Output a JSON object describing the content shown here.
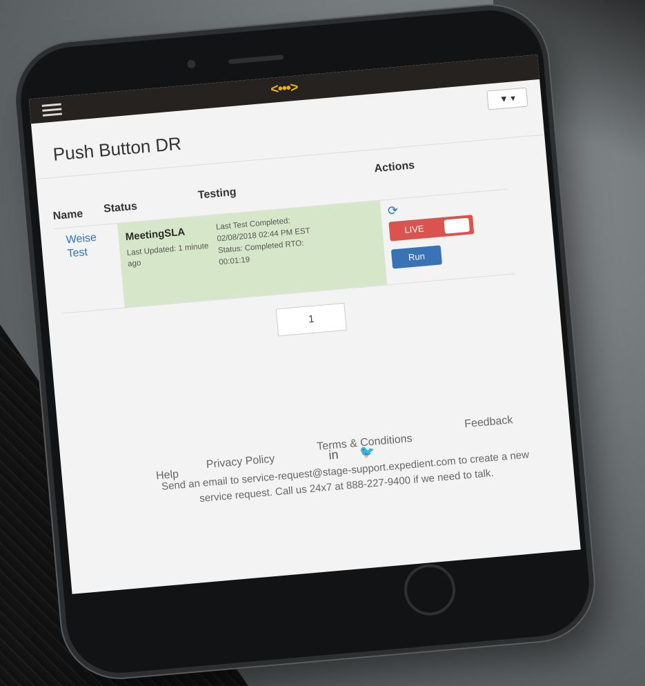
{
  "header": {
    "logo": "<•••>",
    "filter_label": "▼ ▾"
  },
  "page": {
    "title": "Push Button DR"
  },
  "table": {
    "headers": {
      "name": "Name",
      "status": "Status",
      "testing": "Testing",
      "actions": "Actions"
    },
    "rows": [
      {
        "name": "Weise Test",
        "status_name": "MeetingSLA",
        "status_sub": "Last Updated: 1 minute ago",
        "testing_line1": "Last Test Completed:",
        "testing_line2": "02/08/2018 02:44 PM EST",
        "testing_line3": "Status: Completed RTO:",
        "testing_line4": "00:01:19",
        "live_label": "LIVE",
        "run_label": "Run"
      }
    ]
  },
  "pagination": {
    "current": "1"
  },
  "footer": {
    "links": [
      "Help",
      "Privacy Policy",
      "Terms & Conditions",
      "Feedback"
    ],
    "social": [
      "in",
      "🐦"
    ],
    "text": "Send an email to service-request@stage-support.expedient.com to create a new service request. Call us 24x7 at 888-227-9400 if we need to talk."
  },
  "colors": {
    "live": "#d9534f",
    "run": "#3a73b5",
    "link": "#2d73b9",
    "logo": "#e7b119",
    "row_highlight": "#d6e6c9"
  },
  "icons": {
    "menu": "hamburger-icon",
    "refresh": "refresh-icon",
    "filter": "filter-icon"
  }
}
